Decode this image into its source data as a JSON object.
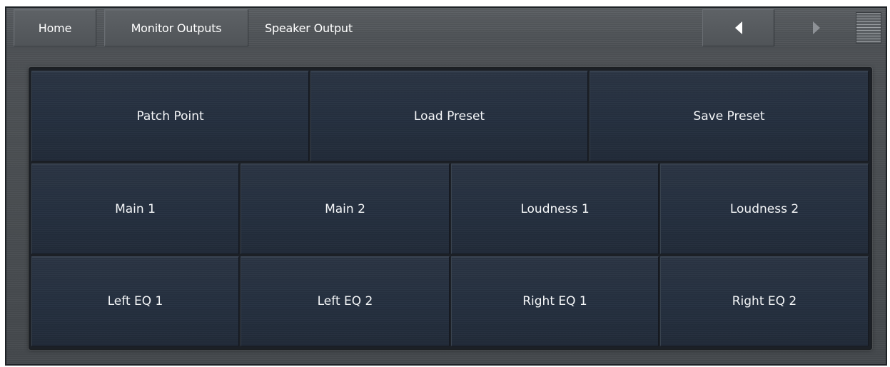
{
  "breadcrumb": {
    "home": "Home",
    "monitor_outputs": "Monitor Outputs",
    "current": "Speaker Output"
  },
  "icons": {
    "back": "arrow-left-icon",
    "forward": "arrow-right-icon",
    "menu": "menu-lines-icon"
  },
  "grid": {
    "row1": [
      "Patch Point",
      "Load Preset",
      "Save Preset"
    ],
    "row2": [
      "Main 1",
      "Main 2",
      "Loudness 1",
      "Loudness 2"
    ],
    "row3": [
      "Left EQ 1",
      "Left EQ 2",
      "Right EQ 1",
      "Right EQ 2"
    ]
  },
  "colors": {
    "tile": "#253040",
    "chrome": "#4c5054",
    "text": "#ffffff"
  }
}
